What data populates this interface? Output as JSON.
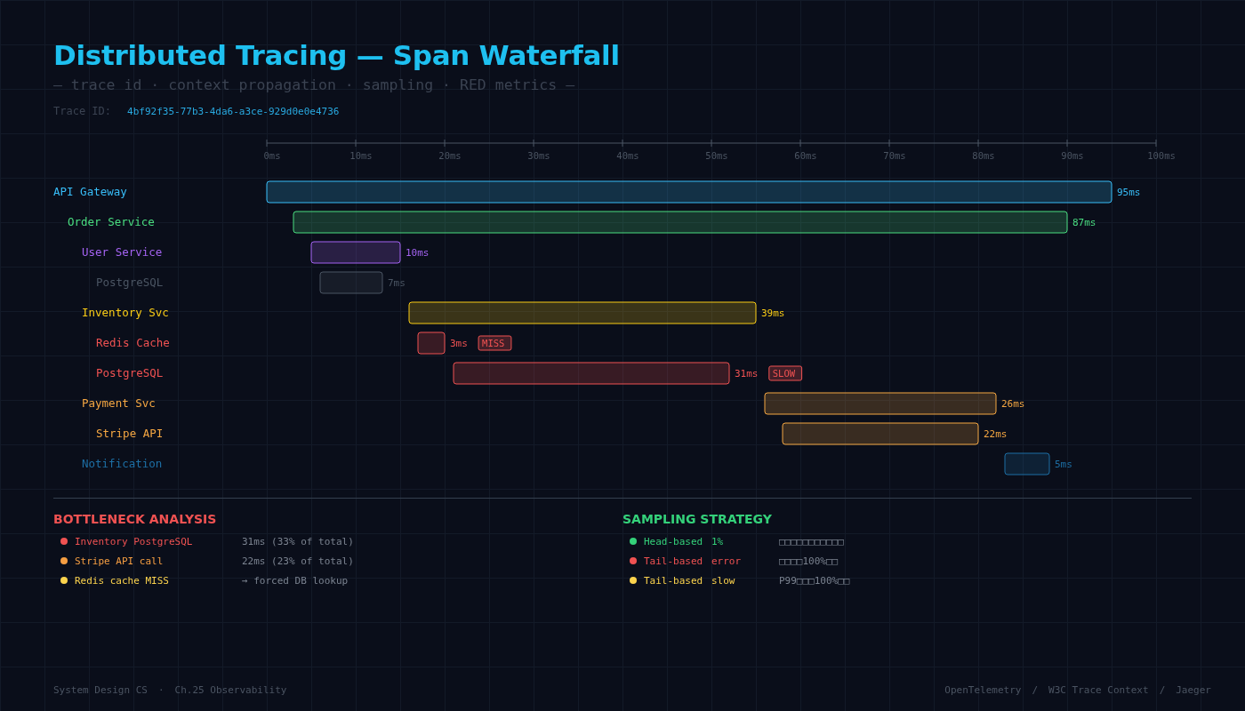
{
  "title": "Distributed Tracing — Span Waterfall",
  "subtitle": "— trace id · context propagation · sampling · RED metrics —",
  "trace": {
    "label": "Trace ID:",
    "value": "4bf92f35-77b3-4da6-a3ce-929d0e0e4736"
  },
  "waterfall": {
    "axis_ticks": [
      "0ms",
      "10ms",
      "20ms",
      "30ms",
      "40ms",
      "50ms",
      "60ms",
      "70ms",
      "80ms",
      "90ms",
      "100ms"
    ],
    "spans": [
      {
        "name": "API Gateway",
        "color": "#38bdf8",
        "duration": "95ms",
        "children": [
          {
            "name": "Order Service",
            "color": "#4ade80",
            "duration": "87ms",
            "children": [
              {
                "name": "User Service",
                "color": "#a463f2",
                "duration": "10ms",
                "children": [
                  {
                    "name": "PostgreSQL",
                    "color": "#4b5563",
                    "duration": "7ms"
                  }
                ]
              },
              {
                "name": "Inventory Svc",
                "color": "#facc15",
                "duration": "39ms",
                "children": [
                  {
                    "name": "Redis Cache",
                    "color": "#f05252",
                    "duration": "3ms",
                    "badge": "MISS"
                  },
                  {
                    "name": "PostgreSQL",
                    "color": "#f05252",
                    "duration": "31ms",
                    "badge": "SLOW"
                  }
                ]
              },
              {
                "name": "Payment Svc",
                "color": "#f5a742",
                "duration": "26ms",
                "children": [
                  {
                    "name": "Stripe API",
                    "color": "#f5a742",
                    "duration": "22ms"
                  }
                ]
              },
              {
                "name": "Notification",
                "color": "#1d6fa5",
                "duration": "5ms"
              }
            ]
          }
        ]
      }
    ]
  },
  "bottleneck": {
    "title": "BOTTLENECK ANALYSIS",
    "items": [
      {
        "color": "#f05252",
        "name": "Inventory PostgreSQL",
        "detail": "31ms (33% of total)"
      },
      {
        "color": "#f59e42",
        "name": "Stripe API call",
        "detail": "22ms (23% of total)"
      },
      {
        "color": "#fcd34d",
        "name": "Redis cache MISS",
        "detail": "→ forced DB lookup"
      }
    ]
  },
  "sampling": {
    "title": "SAMPLING STRATEGY",
    "items": [
      {
        "color": "#34d17a",
        "name": "Head-based",
        "param": "1%",
        "detail": "□□□□□□□□□□□"
      },
      {
        "color": "#f05252",
        "name": "Tail-based",
        "param": "error",
        "detail": "□□□□100%□□"
      },
      {
        "color": "#fcd34d",
        "name": "Tail-based",
        "param": "slow",
        "detail": "P99□□□100%□□"
      }
    ]
  },
  "footer": {
    "left": [
      "System Design CS",
      "·",
      "Ch.25 Observability"
    ],
    "right": [
      "OpenTelemetry",
      "/",
      "W3C Trace Context",
      "/",
      "Jaeger"
    ]
  }
}
